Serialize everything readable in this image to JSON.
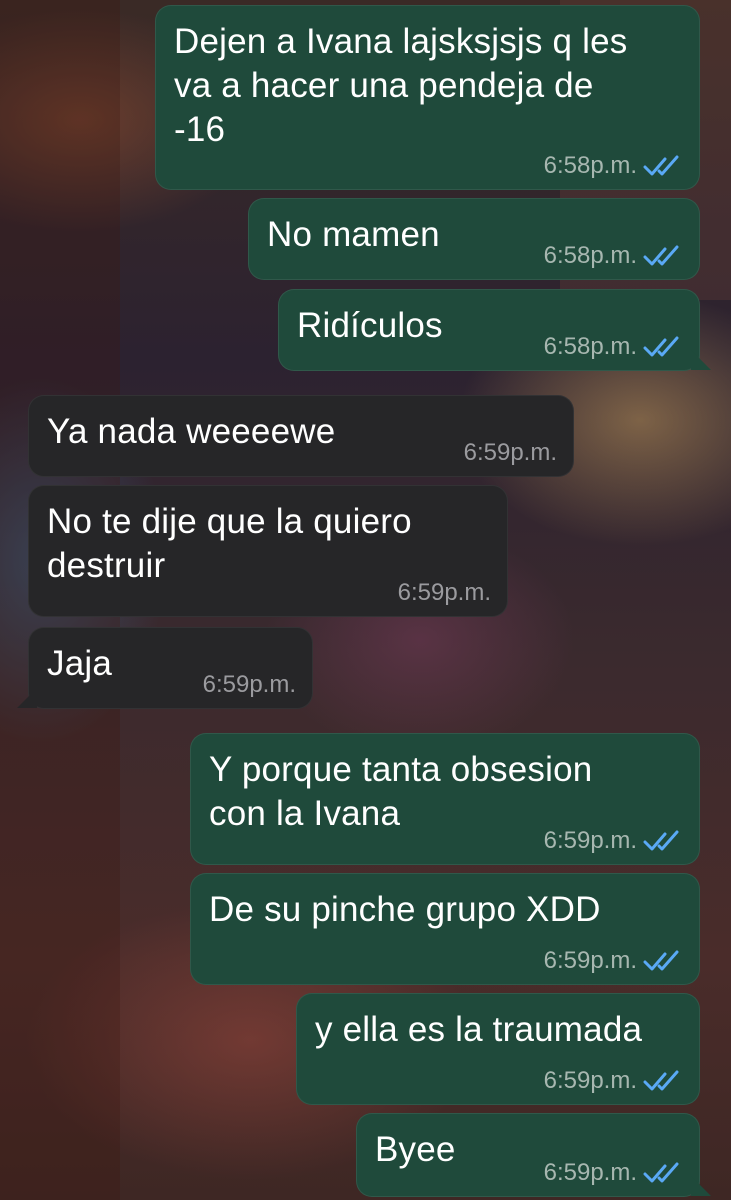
{
  "messages": [
    {
      "direction": "out",
      "text": "Dejen a Ivana lajsksjsjs q les\nva a hacer una pendeja de\n-16",
      "time": "6:58p.m.",
      "read": true
    },
    {
      "direction": "out",
      "text": "No mamen",
      "time": "6:58p.m.",
      "read": true
    },
    {
      "direction": "out",
      "text": "Ridículos",
      "time": "6:58p.m.",
      "read": true
    },
    {
      "direction": "in",
      "text": "Ya nada weeeewe",
      "time": "6:59p.m."
    },
    {
      "direction": "in",
      "text": "No te dije que la quiero\ndestruir",
      "time": "6:59p.m."
    },
    {
      "direction": "in",
      "text": "Jaja",
      "time": "6:59p.m."
    },
    {
      "direction": "out",
      "text": "Y porque tanta obsesion\ncon la Ivana",
      "time": "6:59p.m.",
      "read": true
    },
    {
      "direction": "out",
      "text": "De su pinche grupo XDD",
      "time": "6:59p.m.",
      "read": true
    },
    {
      "direction": "out",
      "text": "y ella es la traumada",
      "time": "6:59p.m.",
      "read": true
    },
    {
      "direction": "out",
      "text": "Byee",
      "time": "6:59p.m.",
      "read": true
    }
  ],
  "colors": {
    "outgoing_bubble": "#1f4a3b",
    "incoming_bubble": "#262628",
    "read_ticks": "#5aa9f5"
  },
  "icons": {
    "read_receipt": "double-check-icon"
  }
}
